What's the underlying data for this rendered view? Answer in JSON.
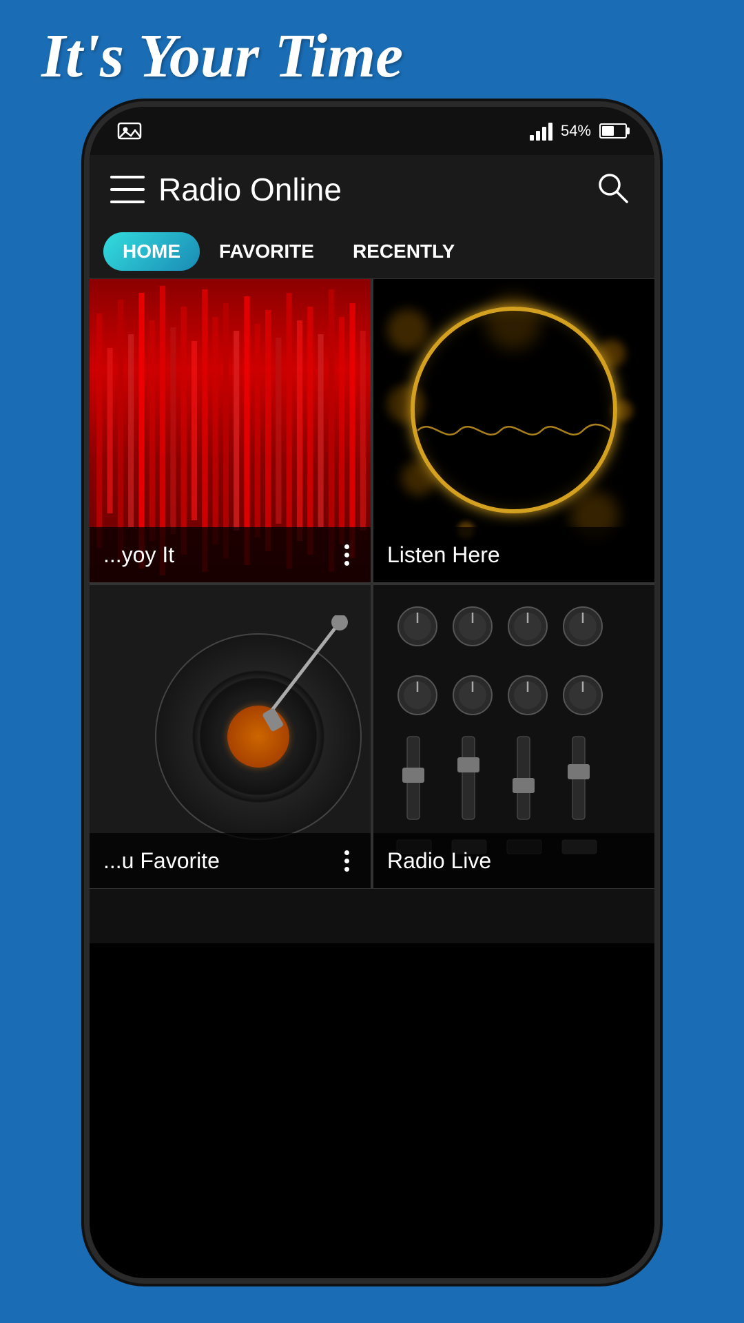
{
  "page": {
    "background_color": "#1a6db5"
  },
  "hero": {
    "title": "It's Your Time"
  },
  "status_bar": {
    "battery_percent": "54%",
    "battery_label": "54%"
  },
  "header": {
    "title": "Radio Online",
    "menu_icon_label": "menu",
    "search_icon_label": "search"
  },
  "nav": {
    "tabs": [
      {
        "label": "HOME",
        "active": true
      },
      {
        "label": "FAVORITE",
        "active": false
      },
      {
        "label": "RECENTLY",
        "active": false
      }
    ]
  },
  "grid": {
    "items": [
      {
        "label": "...yoy It",
        "has_more": true,
        "type": "red-waveform"
      },
      {
        "label": "Listen Here",
        "has_more": false,
        "type": "gold-bokeh"
      },
      {
        "label": "...u Favorite",
        "has_more": true,
        "type": "vinyl"
      },
      {
        "label": "Radio Live",
        "has_more": false,
        "type": "dj-mixer"
      }
    ]
  }
}
